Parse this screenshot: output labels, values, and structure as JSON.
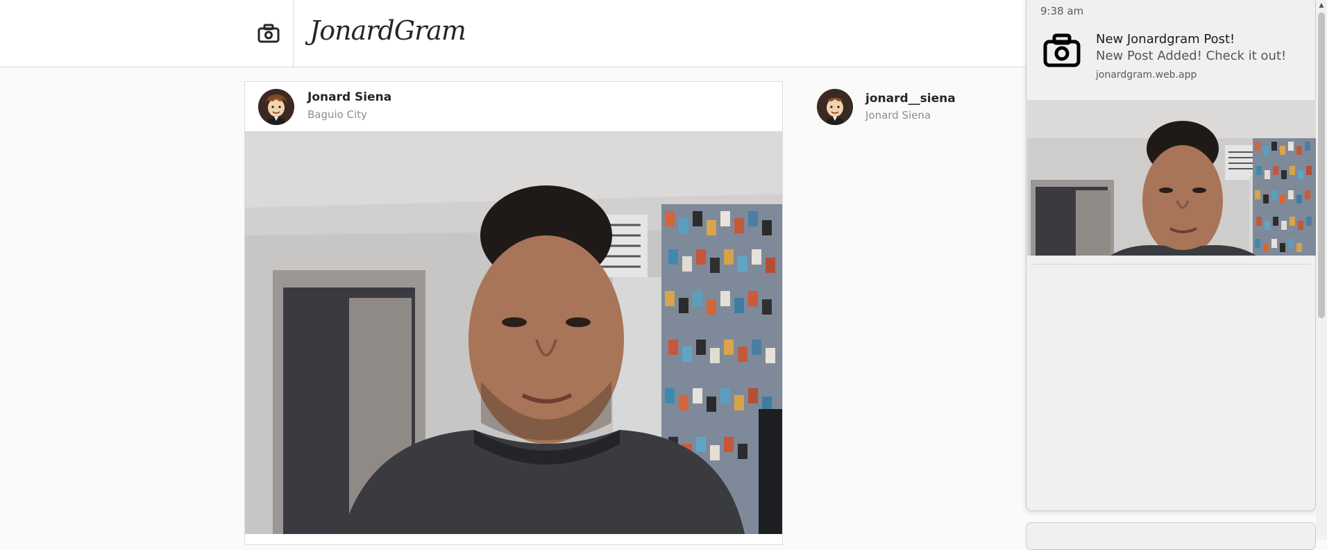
{
  "header": {
    "brand": "JonardGram",
    "camera_icon": "camera-icon"
  },
  "post": {
    "username": "Jonard Siena",
    "location": "Baguio City",
    "avatar_icon": "cartoon-avatar"
  },
  "sidebar": {
    "handle": "jonard__siena",
    "name": "Jonard Siena"
  },
  "notification": {
    "time": "9:38 am",
    "title": "New Jonardgram Post!",
    "body": "New Post Added! Check it out!",
    "site": "jonardgram.web.app",
    "icon": "camera-icon"
  },
  "colors": {
    "background": "#fafafa",
    "border": "#dbdbdb",
    "secondary_text": "#8e8e8e",
    "notification_bg": "#f0f0f0"
  }
}
